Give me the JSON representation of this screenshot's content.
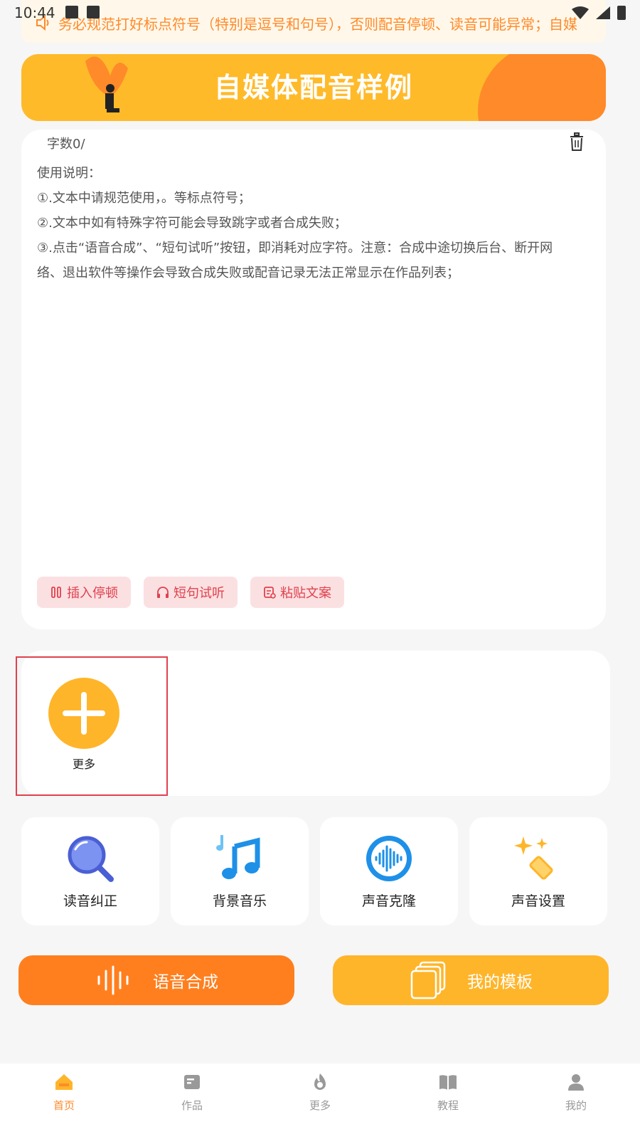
{
  "status": {
    "time": "10:44"
  },
  "notice": {
    "text": "务必规范打好标点符号（特别是逗号和句号），否则配音停顿、读音可能异常；自媒"
  },
  "banner": {
    "title": "自媒体配音样例"
  },
  "editor": {
    "word_count": "字数0/",
    "lines": [
      "使用说明：",
      "①.文本中请规范使用，。等标点符号；",
      "②.文本中如有特殊字符可能会导致跳字或者合成失败；",
      "③.点击“语音合成”、“短句试听”按钮，即消耗对应字符。注意：合成中途切换后台、断开网络、退出软件等操作会导致合成失败或配音记录无法正常显示在作品列表；"
    ],
    "chips": [
      "插入停顿",
      "短句试听",
      "粘贴文案"
    ]
  },
  "more": {
    "label": "更多"
  },
  "tools": [
    "读音纠正",
    "背景音乐",
    "声音克隆",
    "声音设置"
  ],
  "actions": {
    "synth": "语音合成",
    "template": "我的模板"
  },
  "tabs": [
    "首页",
    "作品",
    "更多",
    "教程",
    "我的"
  ],
  "colors": {
    "accent": "#ff8a2a",
    "yellow": "#ffb52a",
    "chip_text": "#e0414c",
    "chip_bg": "#fbe0e2"
  }
}
